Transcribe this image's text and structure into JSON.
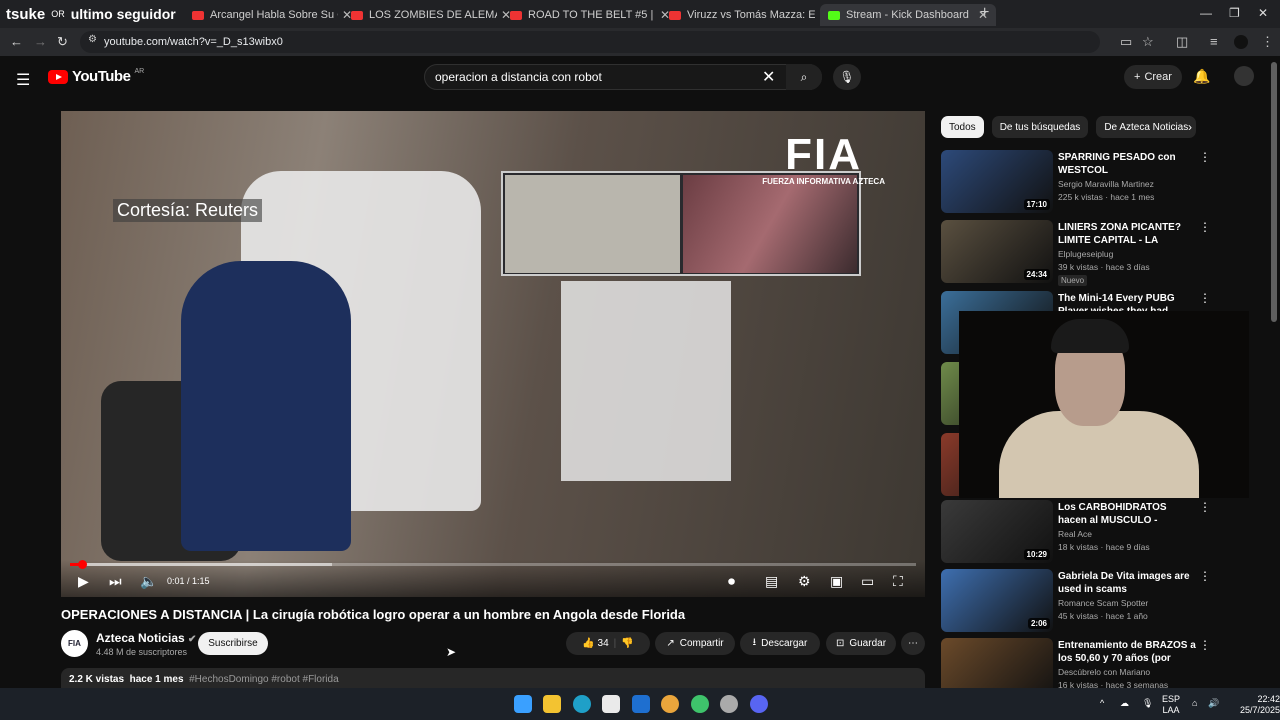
{
  "overlay": {
    "text1": "tsuke",
    "text2": "OR",
    "text3": "ultimo seguidor"
  },
  "tabs": [
    {
      "label": "Arcangel Habla Sobre Su Oper"
    },
    {
      "label": "LOS ZOMBIES DE ALEMANIA (E"
    },
    {
      "label": "ROAD TO THE BELT #5 | Miami"
    },
    {
      "label": "Viruzz vs Tomás Mazza: El Pesaj"
    },
    {
      "label": "Stream - Kick Dashboard"
    }
  ],
  "address": {
    "url": "youtube.com/watch?v=_D_s13wibx0"
  },
  "header": {
    "logo": "YouTube",
    "country": "AR",
    "search_value": "operacion a distancia con robot",
    "create_label": "Crear"
  },
  "video": {
    "overlay_text": "Cortesía: Reuters",
    "brand_big": "FIA",
    "brand_small": "FUERZA INFORMATIVA AZTECA",
    "current_time": "0:01",
    "duration": "1:15",
    "timecode": "0:01 / 1:15",
    "progress": 0.014,
    "buffered": 0.31,
    "title": "OPERACIONES A DISTANCIA | La cirugía robótica logro operar a un hombre en Angola desde Florida"
  },
  "channel": {
    "avatar_text": "FIA",
    "name": "Azteca Noticias",
    "subscribers": "4.48 M de suscriptores",
    "subscribe_label": "Suscribirse"
  },
  "actions": {
    "likes": "34",
    "share": "Compartir",
    "download": "Descargar",
    "save": "Guardar"
  },
  "description": {
    "views": "2.2 K vistas",
    "date": "hace 1 mes",
    "tags": "#HechosDomingo #robot #Florida"
  },
  "chips": [
    "Todos",
    "De tus búsquedas",
    "De Azteca Noticias"
  ],
  "recommendations": [
    {
      "title": "SPARRING PESADO con WESTCOL",
      "channel": "Sergio Maravilla Martinez",
      "meta": "225 k vistas · hace 1 mes",
      "duration": "17:10",
      "badge": "",
      "color": "#2d4a7a"
    },
    {
      "title": "LINIERS ZONA PICANTE? LIMITE CAPITAL - LA MATANZA",
      "channel": "Elplugeseiplug",
      "meta": "39 k vistas · hace 3 días",
      "duration": "24:34",
      "badge": "Nuevo",
      "color": "#5a5040"
    },
    {
      "title": "The Mini-14 Every PUBG Player wishes they had",
      "channel": "",
      "meta": "",
      "duration": "",
      "badge": "",
      "color": "#3b6f9a"
    },
    {
      "title": "",
      "channel": "",
      "meta": "",
      "duration": "",
      "badge": "",
      "color": "#6f8b4a"
    },
    {
      "title": "",
      "channel": "",
      "meta": "",
      "duration": "",
      "badge": "",
      "color": "#8a3a2a"
    },
    {
      "title": "Los CARBOHIDRATOS hacen al MUSCULO - Analisis",
      "channel": "Real Ace",
      "meta": "18 k vistas · hace 9 días",
      "duration": "10:29",
      "badge": "",
      "color": "#3a3a3a"
    },
    {
      "title": "Gabriela De Vita images are used in scams",
      "channel": "Romance Scam Spotter",
      "meta": "45 k vistas · hace 1 año",
      "duration": "2:06",
      "badge": "",
      "color": "#3e6fb0"
    },
    {
      "title": "Entrenamiento de BRAZOS a los 50,60 y 70 años (por entrenad...",
      "channel": "Descúbrelo con Mariano",
      "meta": "16 k vistas · hace 3 semanas",
      "duration": "",
      "badge": "",
      "color": "#6b4a2a"
    }
  ],
  "taskbar": {
    "lang1": "ESP",
    "lang2": "LAA",
    "time": "22:42",
    "date": "25/7/2025"
  }
}
